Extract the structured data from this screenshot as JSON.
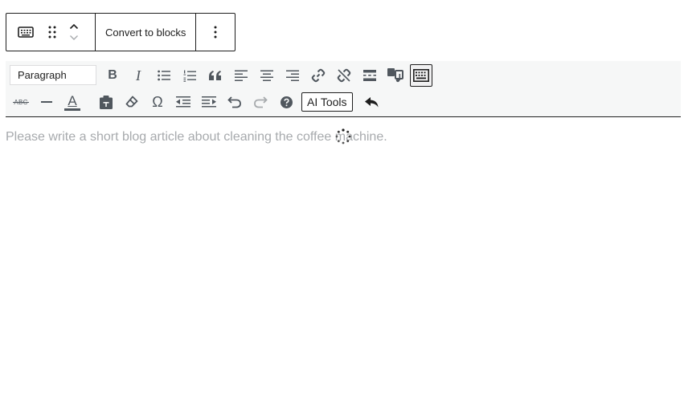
{
  "block_toolbar": {
    "convert_label": "Convert to blocks"
  },
  "classic_toolbar": {
    "format_value": "Paragraph",
    "bold_label": "B",
    "italic_label": "I",
    "strikethrough_label": "ABC",
    "text_color_label": "A",
    "omega_label": "Ω",
    "ai_tools_label": "AI Tools"
  },
  "editor": {
    "placeholder": "Please write a short blog article about cleaning the coffee machine."
  },
  "colors": {
    "toolbar_bg": "#f6f7f7",
    "border": "#1e1e1e",
    "icon": "#50575e",
    "placeholder": "#a7aaad"
  },
  "icons": [
    "keyboard-icon",
    "drag-handle-icon",
    "chevron-up-icon",
    "chevron-down-icon",
    "more-vertical-icon",
    "bold-icon",
    "italic-icon",
    "bullet-list-icon",
    "numbered-list-icon",
    "quote-icon",
    "align-left-icon",
    "align-center-icon",
    "align-right-icon",
    "link-icon",
    "unlink-icon",
    "read-more-icon",
    "add-media-icon",
    "kitchen-sink-icon",
    "strikethrough-icon",
    "horizontal-line-icon",
    "text-color-icon",
    "paste-text-icon",
    "clear-formatting-icon",
    "special-character-icon",
    "outdent-icon",
    "indent-icon",
    "undo-icon",
    "redo-icon",
    "help-icon",
    "reply-icon",
    "loading-spinner-icon"
  ]
}
